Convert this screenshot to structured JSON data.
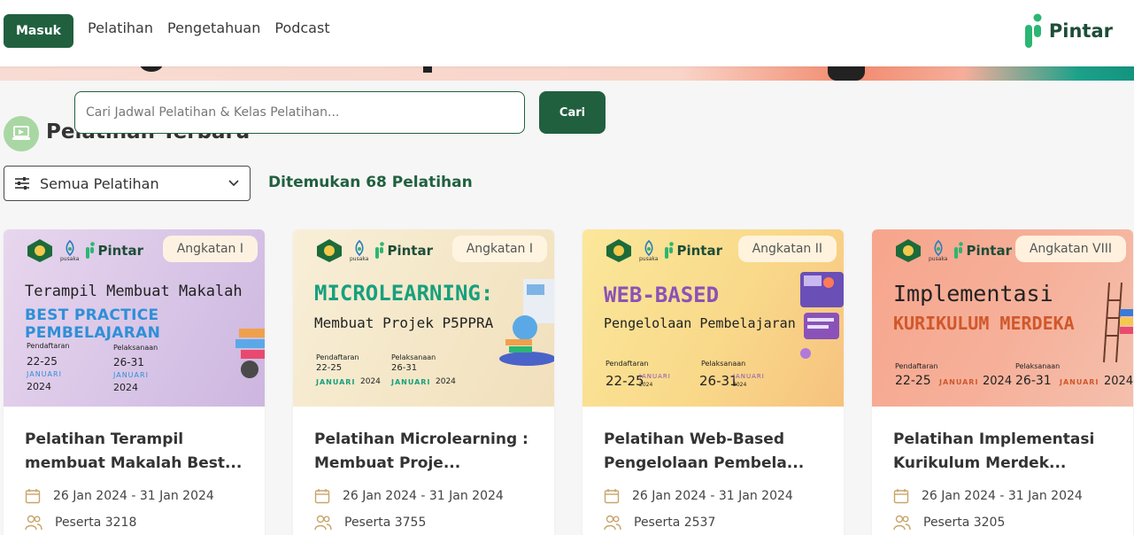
{
  "nav": {
    "login_label": "Masuk",
    "links": [
      "Pelatihan",
      "Pengetahuan",
      "Podcast"
    ],
    "brand": "Pintar"
  },
  "search": {
    "placeholder": "Cari Jadwal Pelatihan & Kelas Pelatihan...",
    "button_label": "Cari"
  },
  "section": {
    "title": "Pelatihan Terbaru",
    "filter_label": "Semua Pelatihan",
    "found_text": "Ditemukan 68 Pelatihan"
  },
  "colors": {
    "primary": "#21603f",
    "brand_text": "#1e4d37",
    "brand_green": "#2bb673"
  },
  "banner_logos": {
    "pusaka": "pusaka",
    "pintar": "Pintar"
  },
  "cards": [
    {
      "badge": "Angkatan I",
      "banner_line1": "Terampil Membuat Makalah",
      "banner_line2": "BEST PRACTICE PEMBELAJARAN",
      "reg_label": "Pendaftaran",
      "reg_dates": "22-25",
      "reg_month": "JANUARI",
      "reg_year": "2024",
      "impl_label": "Pelaksanaan",
      "impl_dates": "26-31",
      "impl_month": "JANUARI",
      "impl_year": "2024",
      "title": "Pelatihan Terampil membuat Makalah Best...",
      "date_range": "26 Jan 2024 - 31 Jan 2024",
      "participants": "Peserta 3218"
    },
    {
      "badge": "Angkatan I",
      "banner_line1": "MICROLEARNING:",
      "banner_line2": "Membuat Projek P5PPRA",
      "reg_label": "Pendaftaran",
      "reg_dates": "22-25",
      "reg_month": "JANUARI",
      "reg_year": "2024",
      "impl_label": "Pelaksanaan",
      "impl_dates": "26-31",
      "impl_month": "JANUARI",
      "impl_year": "2024",
      "title": "Pelatihan Microlearning : Membuat Proje...",
      "date_range": "26 Jan 2024 - 31 Jan 2024",
      "participants": "Peserta 3755"
    },
    {
      "badge": "Angkatan II",
      "banner_line1": "WEB-BASED",
      "banner_line2": "Pengelolaan Pembelajaran",
      "reg_label": "Pendaftaran",
      "reg_dates": "22-25",
      "reg_month": "JANUARI",
      "reg_year": "2024",
      "impl_label": "Pelaksanaan",
      "impl_dates": "26-31",
      "impl_month": "JANUARI",
      "impl_year": "2024",
      "title": "Pelatihan Web-Based Pengelolaan Pembela...",
      "date_range": "26 Jan 2024 - 31 Jan 2024",
      "participants": "Peserta 2537"
    },
    {
      "badge": "Angkatan VIII",
      "banner_line1": "Implementasi",
      "banner_line2": "KURIKULUM MERDEKA",
      "reg_label": "Pendaftaran",
      "reg_dates": "22-25",
      "reg_month": "JANUARI",
      "reg_year": "2024",
      "impl_label": "Pelaksanaan",
      "impl_dates": "26-31",
      "impl_month": "JANUARI",
      "impl_year": "2024",
      "title": "Pelatihan Implementasi Kurikulum Merdek...",
      "date_range": "26 Jan 2024 - 31 Jan 2024",
      "participants": "Peserta 3205"
    }
  ]
}
